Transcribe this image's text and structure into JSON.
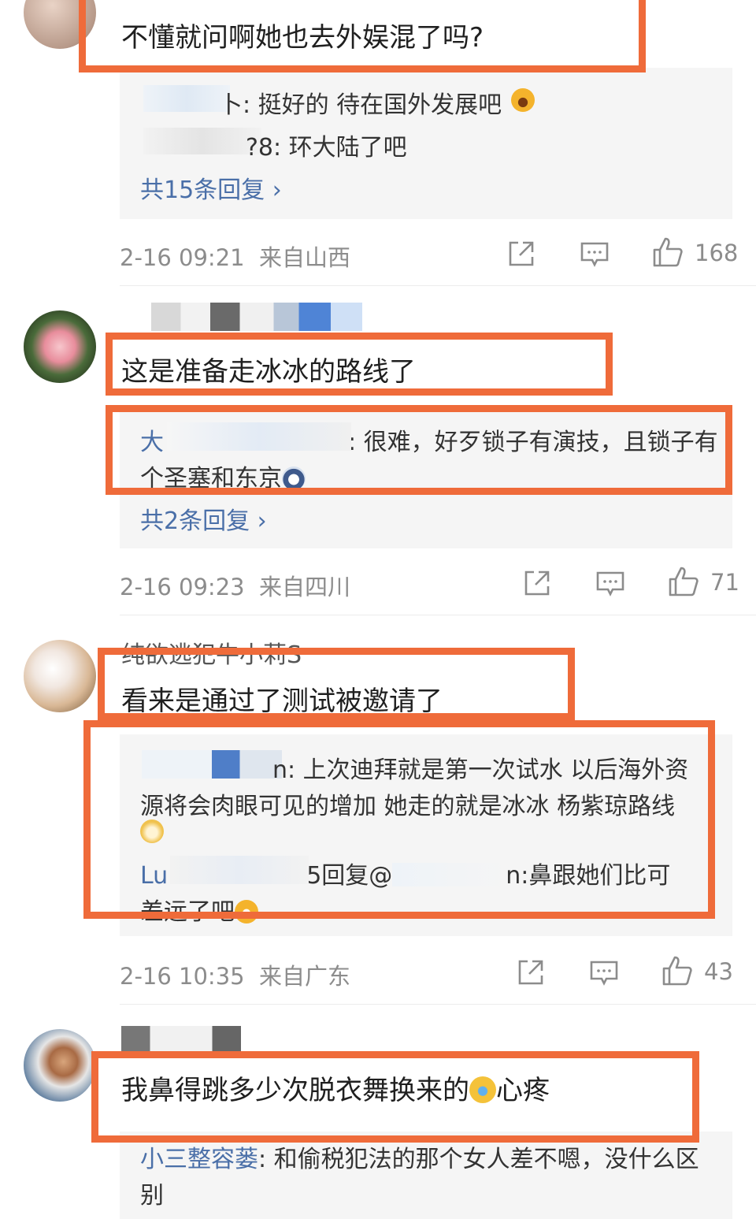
{
  "comments": [
    {
      "text": "不懂就问啊她也去外娱混了吗?",
      "replies": [
        {
          "name": "",
          "text": "卜: 挺好的 待在国外发展吧"
        },
        {
          "name": "",
          "text": "?8: 环大陆了吧"
        }
      ],
      "more": "共15条回复",
      "time": "2-16 09:21",
      "location": "来自山西",
      "likes": "168"
    },
    {
      "username": "",
      "text": "这是准备走冰冰的路线了",
      "replies": [
        {
          "name": "大",
          "text": ": 很难，好歹锁子有演技，且锁子有"
        },
        {
          "name": "",
          "text": "个圣塞和东京"
        }
      ],
      "more": "共2条回复",
      "time": "2-16 09:23",
      "location": "来自四川",
      "likes": "71"
    },
    {
      "username": "纯欲逃犯牛小莉S",
      "text": "看来是通过了测试被邀请了",
      "replies": [
        {
          "name": "",
          "text": "n: 上次迪拜就是第一次试水 以后海外资"
        },
        {
          "name": "",
          "text": "源将会肉眼可见的增加 她走的就是冰冰 杨紫琼路线"
        },
        {
          "name": "Lu",
          "text": "5回复@"
        },
        {
          "name": "",
          "text": "n:鼻跟她们比可"
        },
        {
          "name": "",
          "text": "差远了吧"
        }
      ],
      "time": "2-16 10:35",
      "location": "来自广东",
      "likes": "43"
    },
    {
      "username": "",
      "text": "我鼻得跳多少次脱衣舞换来的",
      "text_suffix": "心疼",
      "replies": [
        {
          "name": "小三整容蒌",
          "text": ": 和偷税犯法的那个女人差不嗯，没什么区"
        },
        {
          "name": "",
          "text": "别"
        }
      ]
    }
  ],
  "colors": {
    "highlight": "#ef6b3a",
    "link": "#4a6fa8",
    "meta": "#8c8c8c",
    "reply_bg": "#f5f5f5"
  },
  "icons": [
    "share-icon",
    "comment-icon",
    "like-icon"
  ]
}
